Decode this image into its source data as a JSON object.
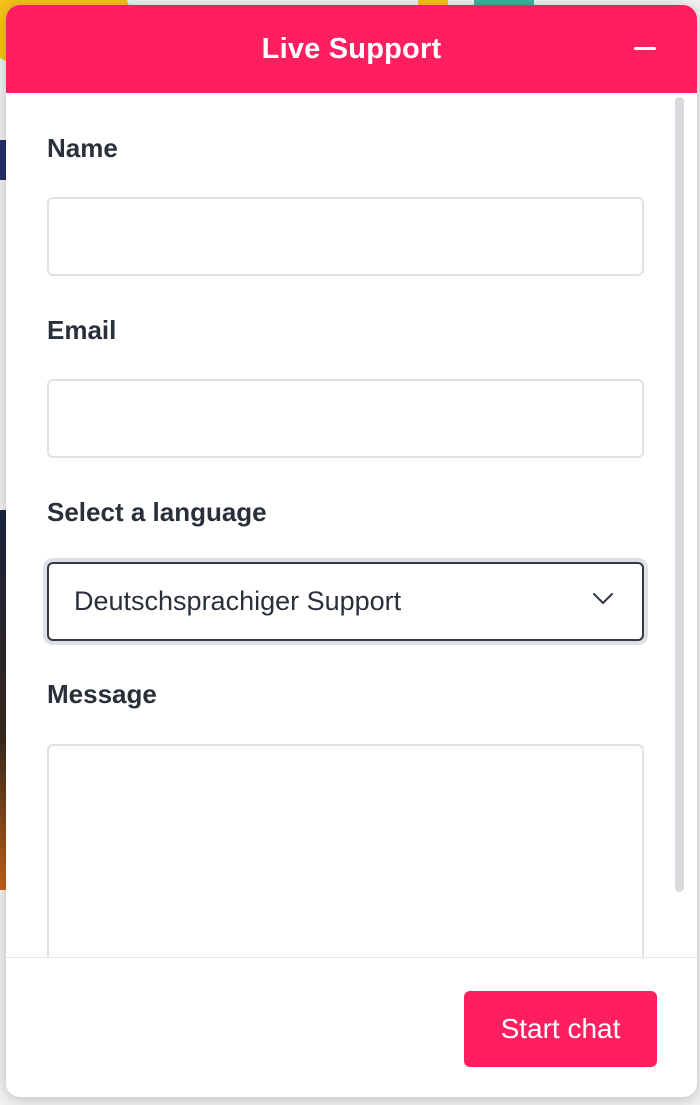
{
  "colors": {
    "accent": "#ff1f60",
    "label_text": "#2a303a",
    "input_border": "#dfe1e4"
  },
  "header": {
    "title": "Live Support",
    "minimize_icon": "minus-icon"
  },
  "form": {
    "name": {
      "label": "Name",
      "value": ""
    },
    "email": {
      "label": "Email",
      "value": ""
    },
    "language": {
      "label": "Select a language",
      "selected": "Deutschsprachiger Support",
      "icon": "chevron-down-icon"
    },
    "message": {
      "label": "Message",
      "value": ""
    }
  },
  "footer": {
    "start_chat_label": "Start chat"
  }
}
